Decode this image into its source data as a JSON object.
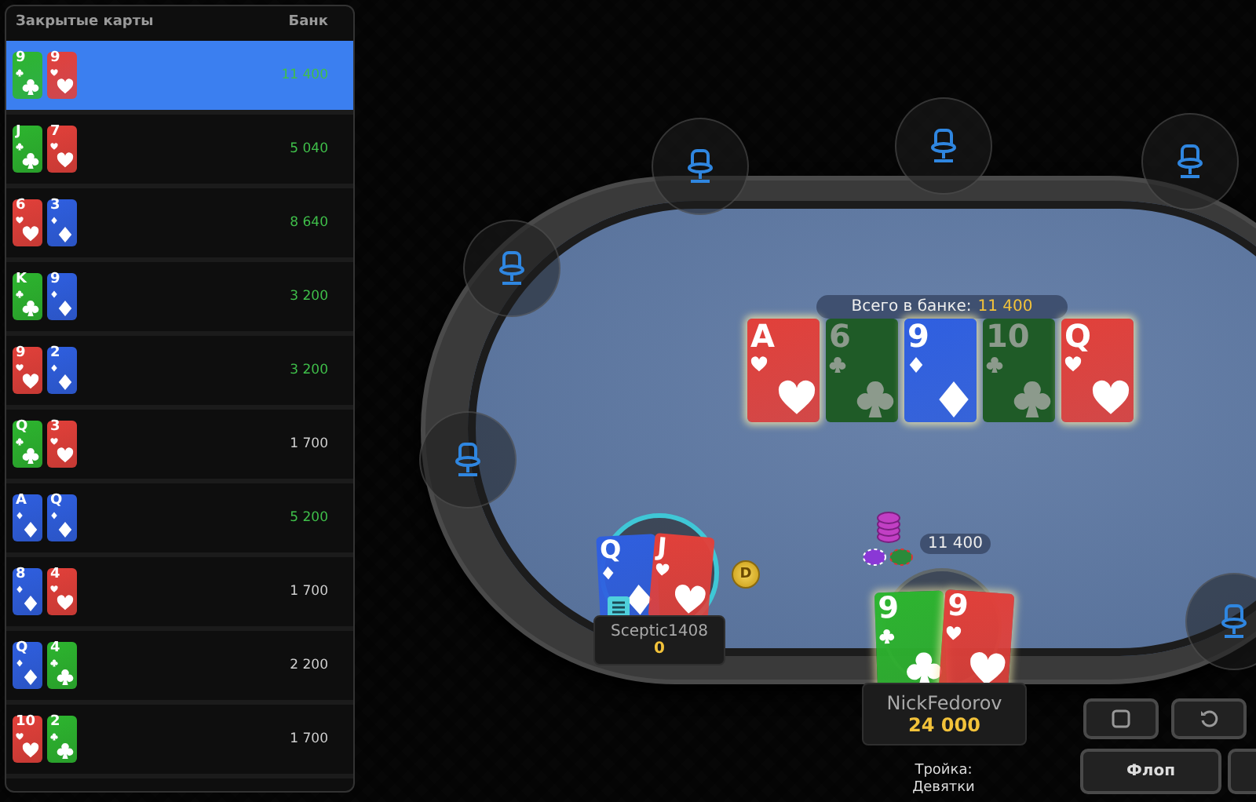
{
  "history": {
    "columns": [
      "Закрытые карты",
      "Банк"
    ],
    "rows": [
      {
        "cards": [
          {
            "rank": "9",
            "kind": "clubs"
          },
          {
            "rank": "9",
            "kind": "hearts"
          }
        ],
        "pot": "11 400",
        "won": true,
        "selected": true
      },
      {
        "cards": [
          {
            "rank": "J",
            "kind": "clubs"
          },
          {
            "rank": "7",
            "kind": "hearts"
          }
        ],
        "pot": "5 040",
        "won": true,
        "selected": false
      },
      {
        "cards": [
          {
            "rank": "6",
            "kind": "hearts"
          },
          {
            "rank": "3",
            "kind": "diamonds"
          }
        ],
        "pot": "8 640",
        "won": true,
        "selected": false
      },
      {
        "cards": [
          {
            "rank": "K",
            "kind": "clubs"
          },
          {
            "rank": "9",
            "kind": "diamonds"
          }
        ],
        "pot": "3 200",
        "won": true,
        "selected": false
      },
      {
        "cards": [
          {
            "rank": "9",
            "kind": "hearts"
          },
          {
            "rank": "2",
            "kind": "diamonds"
          }
        ],
        "pot": "3 200",
        "won": true,
        "selected": false
      },
      {
        "cards": [
          {
            "rank": "Q",
            "kind": "clubs"
          },
          {
            "rank": "3",
            "kind": "hearts"
          }
        ],
        "pot": "1 700",
        "won": false,
        "selected": false
      },
      {
        "cards": [
          {
            "rank": "A",
            "kind": "diamonds"
          },
          {
            "rank": "Q",
            "kind": "diamonds"
          }
        ],
        "pot": "5 200",
        "won": true,
        "selected": false
      },
      {
        "cards": [
          {
            "rank": "8",
            "kind": "diamonds"
          },
          {
            "rank": "4",
            "kind": "hearts"
          }
        ],
        "pot": "1 700",
        "won": false,
        "selected": false
      },
      {
        "cards": [
          {
            "rank": "Q",
            "kind": "diamonds"
          },
          {
            "rank": "4",
            "kind": "clubs"
          }
        ],
        "pot": "2 200",
        "won": false,
        "selected": false
      },
      {
        "cards": [
          {
            "rank": "10",
            "kind": "hearts"
          },
          {
            "rank": "2",
            "kind": "clubs"
          }
        ],
        "pot": "1 700",
        "won": false,
        "selected": false
      }
    ]
  },
  "table": {
    "total_pot": {
      "label": "Всего в банке:",
      "amount": "11 400"
    },
    "board": [
      {
        "rank": "A",
        "kind": "hearts",
        "highlighted": true
      },
      {
        "rank": "6",
        "kind": "clubs",
        "highlighted": false
      },
      {
        "rank": "9",
        "kind": "diamonds",
        "highlighted": true
      },
      {
        "rank": "10",
        "kind": "clubs",
        "highlighted": false
      },
      {
        "rank": "Q",
        "kind": "hearts",
        "highlighted": true
      }
    ],
    "pot_chips": "11 400",
    "seats": [
      {
        "kind": "empty"
      },
      {
        "kind": "empty"
      },
      {
        "kind": "empty"
      },
      {
        "kind": "empty"
      },
      {
        "kind": "empty"
      },
      {
        "kind": "player",
        "name": "Sceptic1408",
        "stack": "0",
        "active": true,
        "dealer": "D",
        "cards": [
          {
            "rank": "Q",
            "kind": "diamonds"
          },
          {
            "rank": "J",
            "kind": "hearts"
          }
        ]
      },
      {
        "kind": "player",
        "name": "NickFedorov",
        "stack": "24 000",
        "active": false,
        "hand": "Тройка: Девятки",
        "cards": [
          {
            "rank": "9",
            "kind": "clubs"
          },
          {
            "rank": "9",
            "kind": "hearts"
          }
        ]
      },
      {
        "kind": "empty"
      }
    ]
  },
  "controls": [
    {
      "kind": "stop"
    },
    {
      "kind": "replay"
    },
    {
      "kind": "text",
      "label": "Флоп"
    },
    {
      "kind": "blank"
    }
  ]
}
